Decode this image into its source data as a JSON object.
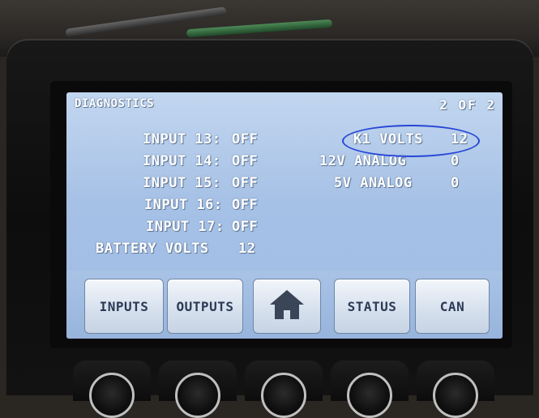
{
  "screen": {
    "title": "DIAGNOSTICS",
    "page_indicator": "2 OF 2"
  },
  "inputs": [
    {
      "label": "INPUT 13:",
      "value": "OFF"
    },
    {
      "label": "INPUT 14:",
      "value": "OFF"
    },
    {
      "label": "INPUT 15:",
      "value": "OFF"
    },
    {
      "label": "INPUT 16:",
      "value": "OFF"
    },
    {
      "label": "INPUT 17:",
      "value": "OFF"
    },
    {
      "label": "BATTERY VOLTS",
      "value": "12"
    }
  ],
  "analog": [
    {
      "label": "K1 VOLTS",
      "value": "12"
    },
    {
      "label": "12V ANALOG",
      "value": "0"
    },
    {
      "label": "5V ANALOG",
      "value": "0"
    }
  ],
  "nav": {
    "inputs": "INPUTS",
    "outputs": "OUTPUTS",
    "home_icon": "home-icon",
    "status": "STATUS",
    "can": "CAN"
  },
  "colors": {
    "screen": "#a6c1e6",
    "highlight_oval": "#2646d6",
    "button_text": "#2b3a55"
  }
}
